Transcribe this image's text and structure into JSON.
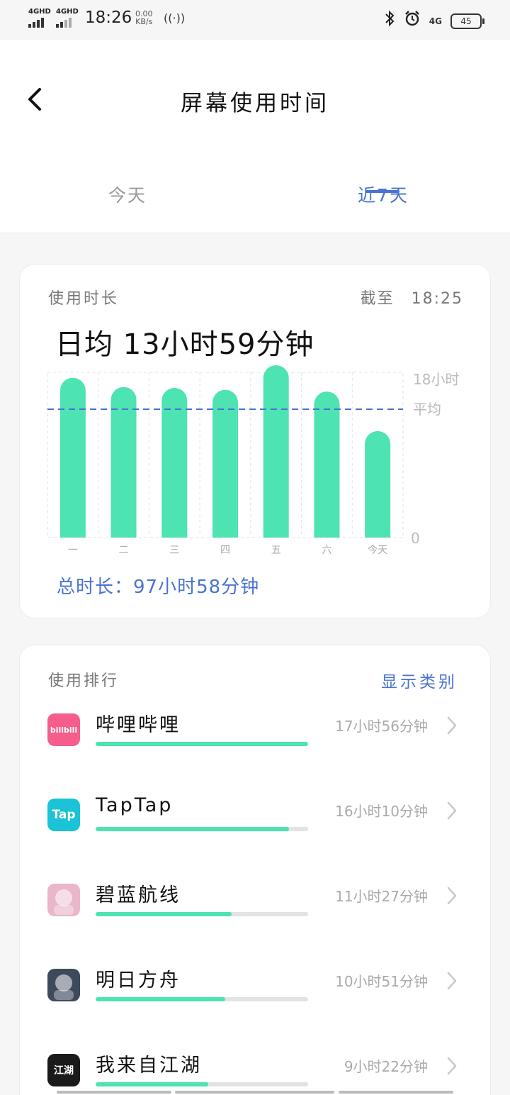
{
  "status_bar": {
    "signal1": "4GHD",
    "signal2": "4GHD",
    "time": "18:26",
    "speed_value": "0.00",
    "speed_unit": "KB/s",
    "net_4g": "4G",
    "battery": "45"
  },
  "header": {
    "title": "屏幕使用时间",
    "tabs": [
      {
        "label": "今天",
        "active": false
      },
      {
        "label": "近7天",
        "active": true
      }
    ]
  },
  "usage": {
    "label": "使用时长",
    "as_of": "截至　18:25",
    "daily_average": "日均  13小时59分钟",
    "total": "总时长：97小时58分钟"
  },
  "chart_data": {
    "type": "bar",
    "categories": [
      "一",
      "二",
      "三",
      "四",
      "五",
      "六",
      "今天"
    ],
    "values": [
      17.4,
      16.4,
      16.3,
      16.1,
      19.2,
      15.9,
      11.6
    ],
    "ylabel": "",
    "ylim": [
      0,
      18
    ],
    "y_tick_labels": [
      "18小时",
      "0"
    ],
    "average_label": "平均",
    "average_value": 13.98,
    "grid": true,
    "colors": {
      "bar": "#4de3b3",
      "average_line": "#4a72d1"
    }
  },
  "ranking": {
    "label": "使用排行",
    "show_categories": "显示类别",
    "apps": [
      {
        "name": "哔哩哔哩",
        "time": "17小时56分钟",
        "fraction": 1.0,
        "icon": "bilibili-icon",
        "icon_text": "bilibili",
        "color": "#f45d8c"
      },
      {
        "name": "TapTap",
        "time": "16小时10分钟",
        "fraction": 0.91,
        "icon": "taptap-icon",
        "icon_text": "Tap",
        "color": "#1ac3d6"
      },
      {
        "name": "碧蓝航线",
        "time": "11小时27分钟",
        "fraction": 0.64,
        "icon": "azur-lane-icon",
        "icon_text": "",
        "color": "#e9b7c9"
      },
      {
        "name": "明日方舟",
        "time": "10小时51分钟",
        "fraction": 0.61,
        "icon": "arknights-icon",
        "icon_text": "",
        "color": "#3d4a5c"
      },
      {
        "name": "我来自江湖",
        "time": "9小时22分钟",
        "fraction": 0.53,
        "icon": "jianghu-icon",
        "icon_text": "江湖",
        "color": "#1a1a1a"
      }
    ]
  }
}
